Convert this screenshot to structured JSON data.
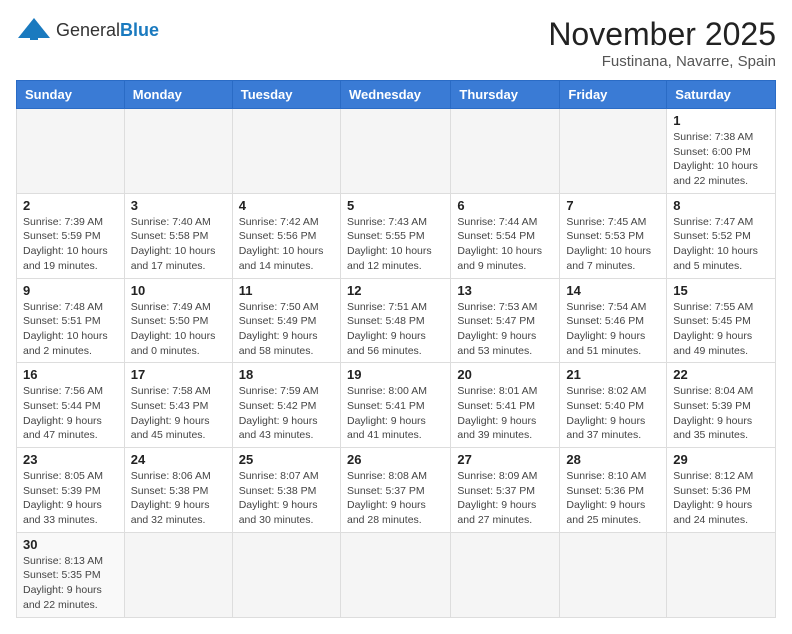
{
  "logo": {
    "text_general": "General",
    "text_blue": "Blue"
  },
  "title": "November 2025",
  "location": "Fustinana, Navarre, Spain",
  "weekdays": [
    "Sunday",
    "Monday",
    "Tuesday",
    "Wednesday",
    "Thursday",
    "Friday",
    "Saturday"
  ],
  "days": {
    "1": {
      "sunrise": "7:38 AM",
      "sunset": "6:00 PM",
      "daylight": "10 hours and 22 minutes."
    },
    "2": {
      "sunrise": "7:39 AM",
      "sunset": "5:59 PM",
      "daylight": "10 hours and 19 minutes."
    },
    "3": {
      "sunrise": "7:40 AM",
      "sunset": "5:58 PM",
      "daylight": "10 hours and 17 minutes."
    },
    "4": {
      "sunrise": "7:42 AM",
      "sunset": "5:56 PM",
      "daylight": "10 hours and 14 minutes."
    },
    "5": {
      "sunrise": "7:43 AM",
      "sunset": "5:55 PM",
      "daylight": "10 hours and 12 minutes."
    },
    "6": {
      "sunrise": "7:44 AM",
      "sunset": "5:54 PM",
      "daylight": "10 hours and 9 minutes."
    },
    "7": {
      "sunrise": "7:45 AM",
      "sunset": "5:53 PM",
      "daylight": "10 hours and 7 minutes."
    },
    "8": {
      "sunrise": "7:47 AM",
      "sunset": "5:52 PM",
      "daylight": "10 hours and 5 minutes."
    },
    "9": {
      "sunrise": "7:48 AM",
      "sunset": "5:51 PM",
      "daylight": "10 hours and 2 minutes."
    },
    "10": {
      "sunrise": "7:49 AM",
      "sunset": "5:50 PM",
      "daylight": "10 hours and 0 minutes."
    },
    "11": {
      "sunrise": "7:50 AM",
      "sunset": "5:49 PM",
      "daylight": "9 hours and 58 minutes."
    },
    "12": {
      "sunrise": "7:51 AM",
      "sunset": "5:48 PM",
      "daylight": "9 hours and 56 minutes."
    },
    "13": {
      "sunrise": "7:53 AM",
      "sunset": "5:47 PM",
      "daylight": "9 hours and 53 minutes."
    },
    "14": {
      "sunrise": "7:54 AM",
      "sunset": "5:46 PM",
      "daylight": "9 hours and 51 minutes."
    },
    "15": {
      "sunrise": "7:55 AM",
      "sunset": "5:45 PM",
      "daylight": "9 hours and 49 minutes."
    },
    "16": {
      "sunrise": "7:56 AM",
      "sunset": "5:44 PM",
      "daylight": "9 hours and 47 minutes."
    },
    "17": {
      "sunrise": "7:58 AM",
      "sunset": "5:43 PM",
      "daylight": "9 hours and 45 minutes."
    },
    "18": {
      "sunrise": "7:59 AM",
      "sunset": "5:42 PM",
      "daylight": "9 hours and 43 minutes."
    },
    "19": {
      "sunrise": "8:00 AM",
      "sunset": "5:41 PM",
      "daylight": "9 hours and 41 minutes."
    },
    "20": {
      "sunrise": "8:01 AM",
      "sunset": "5:41 PM",
      "daylight": "9 hours and 39 minutes."
    },
    "21": {
      "sunrise": "8:02 AM",
      "sunset": "5:40 PM",
      "daylight": "9 hours and 37 minutes."
    },
    "22": {
      "sunrise": "8:04 AM",
      "sunset": "5:39 PM",
      "daylight": "9 hours and 35 minutes."
    },
    "23": {
      "sunrise": "8:05 AM",
      "sunset": "5:39 PM",
      "daylight": "9 hours and 33 minutes."
    },
    "24": {
      "sunrise": "8:06 AM",
      "sunset": "5:38 PM",
      "daylight": "9 hours and 32 minutes."
    },
    "25": {
      "sunrise": "8:07 AM",
      "sunset": "5:38 PM",
      "daylight": "9 hours and 30 minutes."
    },
    "26": {
      "sunrise": "8:08 AM",
      "sunset": "5:37 PM",
      "daylight": "9 hours and 28 minutes."
    },
    "27": {
      "sunrise": "8:09 AM",
      "sunset": "5:37 PM",
      "daylight": "9 hours and 27 minutes."
    },
    "28": {
      "sunrise": "8:10 AM",
      "sunset": "5:36 PM",
      "daylight": "9 hours and 25 minutes."
    },
    "29": {
      "sunrise": "8:12 AM",
      "sunset": "5:36 PM",
      "daylight": "9 hours and 24 minutes."
    },
    "30": {
      "sunrise": "8:13 AM",
      "sunset": "5:35 PM",
      "daylight": "9 hours and 22 minutes."
    }
  }
}
